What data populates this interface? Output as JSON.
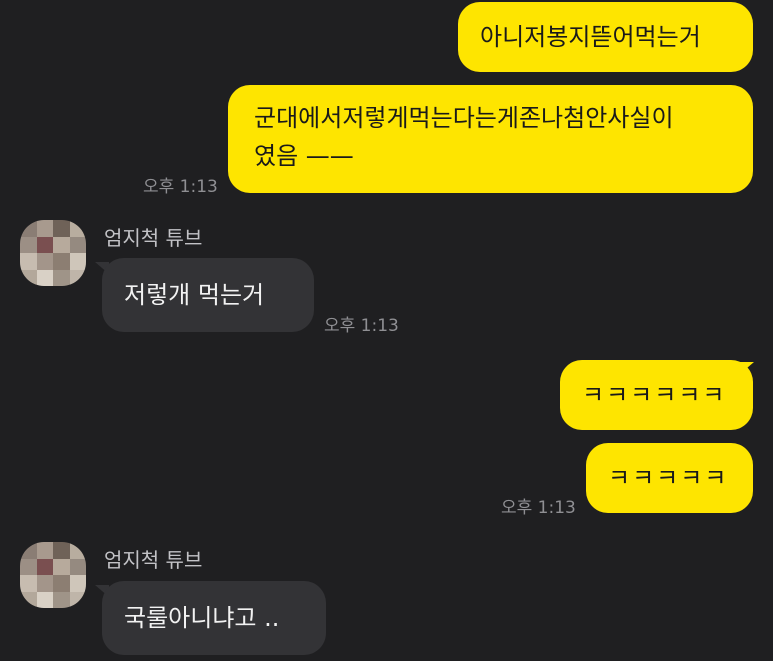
{
  "messages": {
    "m1": {
      "text": "아니저봉지뜯어먹는거"
    },
    "m2": {
      "line1": "군대에서저렇게먹는다는게존나첨안사실이",
      "line2": "였음 ——",
      "time": "오후 1:13"
    },
    "m3": {
      "sender": "엄지척 튜브",
      "text": "저렇개 먹는거",
      "time": "오후 1:13"
    },
    "m4": {
      "text": "ㅋㅋㅋㅋㅋㅋ"
    },
    "m5": {
      "text": "ㅋㅋㅋㅋㅋ",
      "time": "오후 1:13"
    },
    "m6": {
      "sender": "엄지척 튜브",
      "text": "국룰아니냐고 .."
    }
  },
  "colors": {
    "background": "#1f1f21",
    "my_bubble": "#fee500",
    "their_bubble": "#333336",
    "timestamp": "#8f8f93",
    "sender_name": "#c2c2c6"
  },
  "icons": {
    "avatar": "pixelated-profile-avatar"
  }
}
